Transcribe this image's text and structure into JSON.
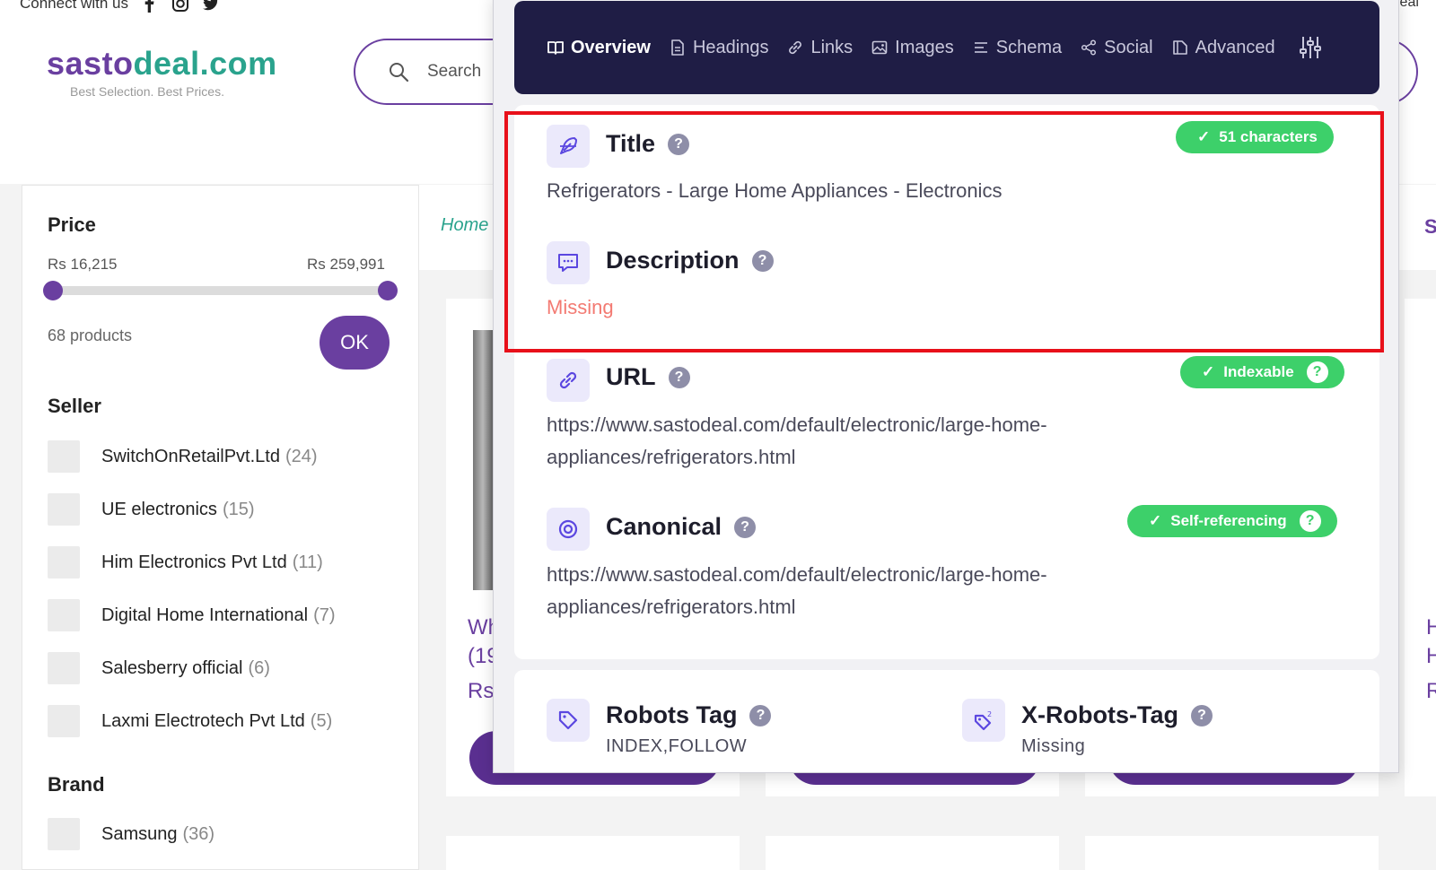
{
  "site": {
    "connect_label": "Connect with us",
    "top_right": "leal",
    "logo_part1": "sasto",
    "logo_part2": "deal.com",
    "tagline": "Best Selection. Best Prices.",
    "search_placeholder": "Search",
    "brand_color": "#6a3fa0",
    "accent_color": "#2aa38d"
  },
  "sidebar": {
    "price_heading": "Price",
    "price_min": "Rs 16,215",
    "price_max": "Rs 259,991",
    "product_count": "68 products",
    "ok_label": "OK",
    "seller_heading": "Seller",
    "sellers": [
      {
        "name": "SwitchOnRetailPvt.Ltd",
        "count": "(24)"
      },
      {
        "name": "UE electronics",
        "count": "(15)"
      },
      {
        "name": "Him Electronics Pvt Ltd",
        "count": "(11)"
      },
      {
        "name": "Digital Home International",
        "count": "(7)"
      },
      {
        "name": "Salesberry official",
        "count": "(6)"
      },
      {
        "name": "Laxmi Electrotech Pvt Ltd",
        "count": "(5)"
      }
    ],
    "brand_heading": "Brand",
    "brands": [
      {
        "name": "Samsung",
        "count": "(36)"
      }
    ]
  },
  "main": {
    "breadcrumb_home": "Home",
    "right_cut": "S",
    "card1_line1": "Wh",
    "card1_line2": "(19",
    "card1_line3": "Rs",
    "card4_line1": "H",
    "card4_line2": "H",
    "card4_line3": "R"
  },
  "seo_panel": {
    "nav": {
      "overview": "Overview",
      "headings": "Headings",
      "links": "Links",
      "images": "Images",
      "schema": "Schema",
      "social": "Social",
      "advanced": "Advanced"
    },
    "title": {
      "label": "Title",
      "value": "Refrigerators - Large Home Appliances - Electronics",
      "badge": "51 characters"
    },
    "description": {
      "label": "Description",
      "value": "Missing"
    },
    "url": {
      "label": "URL",
      "value_line1": "https://www.sastodeal.com/default/electronic/large-home-",
      "value_line2": "appliances/refrigerators.html",
      "badge": "Indexable"
    },
    "canonical": {
      "label": "Canonical",
      "value_line1": "https://www.sastodeal.com/default/electronic/large-home-",
      "value_line2": "appliances/refrigerators.html",
      "badge": "Self-referencing"
    },
    "robots_tag": {
      "label": "Robots Tag",
      "value": "INDEX,FOLLOW"
    },
    "x_robots_tag": {
      "label": "X-Robots-Tag",
      "value": "Missing"
    },
    "help_glyph": "?",
    "check_glyph": "✓",
    "nav_bg": "#1f1d45",
    "ok_green": "#3dd06a",
    "missing_red": "#f37a72",
    "highlight_red": "#e8101a"
  }
}
